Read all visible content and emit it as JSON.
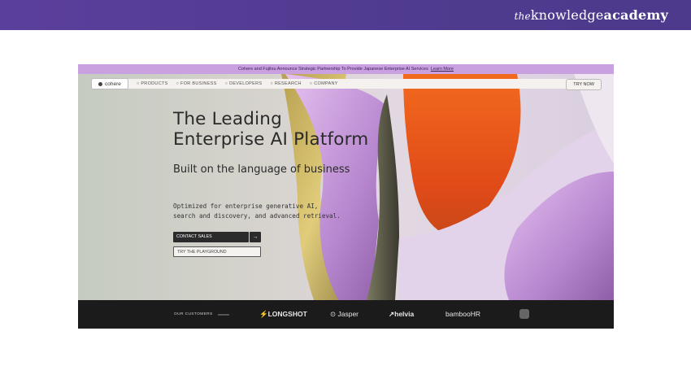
{
  "brand": {
    "the": "the",
    "knowledge": "knowledge",
    "academy": "academy"
  },
  "announcement": {
    "text": "Cohere and Fujitsu Announce Strategic Partnership To Provide Japanese Enterprise AI Services",
    "link": "Learn More"
  },
  "nav": {
    "logo": "cohere",
    "items": [
      "PRODUCTS",
      "FOR BUSINESS",
      "DEVELOPERS",
      "RESEARCH",
      "COMPANY"
    ],
    "try": "TRY NOW"
  },
  "hero": {
    "headline_1": "The Leading",
    "headline_2": "Enterprise AI Platform",
    "subheadline": "Built on the language of business",
    "desc_1": "Optimized for enterprise generative AI,",
    "desc_2": "search and discovery, and advanced retrieval.",
    "cta_contact": "CONTACT SALES",
    "cta_arrow": "→",
    "cta_playground": "TRY THE PLAYGROUND"
  },
  "customers": {
    "label": "OUR CUSTOMERS",
    "logos": [
      "LONGSHOT",
      "Jasper",
      "helvia",
      "bambooHR"
    ]
  },
  "colors": {
    "header": "#4f3b8f",
    "announce": "#c9a0e0",
    "orange": "#e8501c",
    "lilac": "#c9a0e0",
    "olive": "#c7b46a"
  }
}
